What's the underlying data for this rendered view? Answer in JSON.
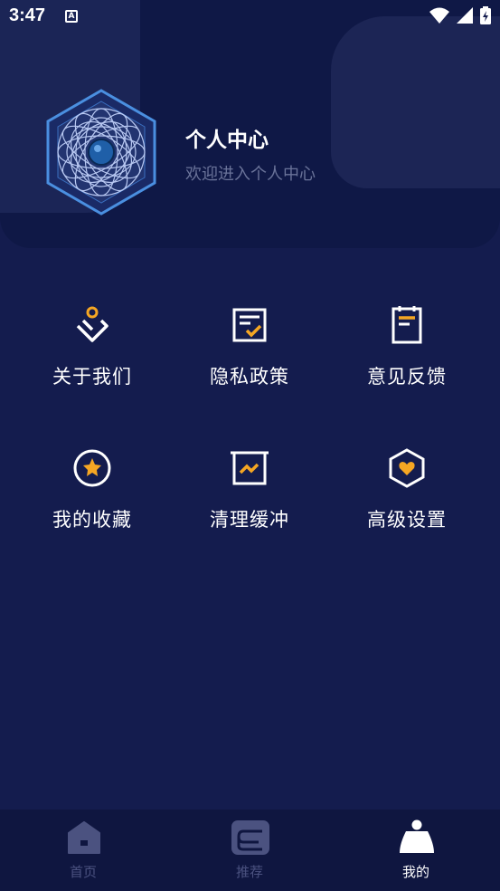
{
  "status_bar": {
    "time": "3:47",
    "badge_letter": "A"
  },
  "profile": {
    "title": "个人中心",
    "subtitle": "欢迎进入个人中心"
  },
  "menu": [
    {
      "label": "关于我们",
      "icon": "about-icon"
    },
    {
      "label": "隐私政策",
      "icon": "privacy-icon"
    },
    {
      "label": "意见反馈",
      "icon": "feedback-icon"
    },
    {
      "label": "我的收藏",
      "icon": "favorites-icon"
    },
    {
      "label": "清理缓冲",
      "icon": "clear-cache-icon"
    },
    {
      "label": "高级设置",
      "icon": "settings-icon"
    }
  ],
  "nav": [
    {
      "label": "首页",
      "icon": "home-icon",
      "active": false
    },
    {
      "label": "推荐",
      "icon": "recommend-icon",
      "active": false
    },
    {
      "label": "我的",
      "icon": "profile-icon",
      "active": true
    }
  ],
  "colors": {
    "accent": "#f5a623",
    "background": "#141c4e",
    "header": "#0f1846",
    "nav_inactive": "#4b5280",
    "nav_active": "#ffffff"
  }
}
